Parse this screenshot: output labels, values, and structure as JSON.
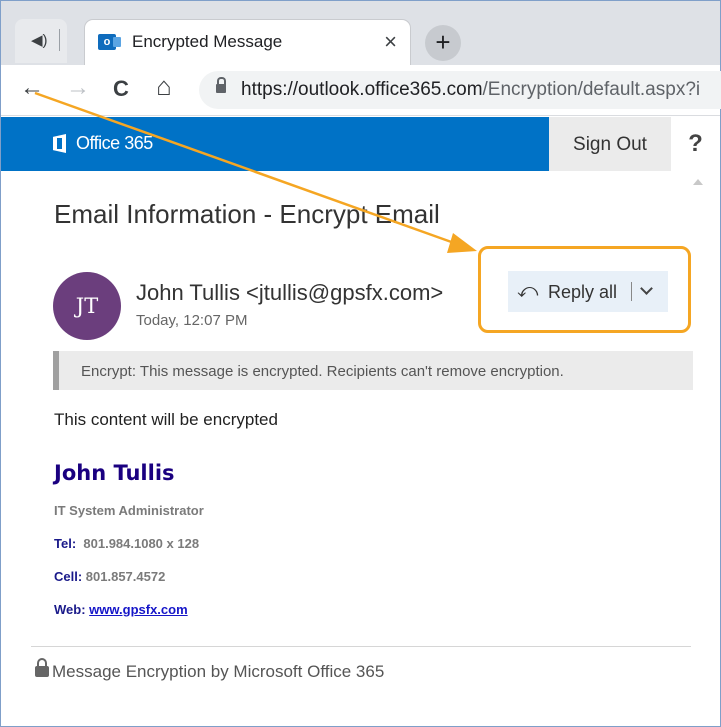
{
  "browser": {
    "tab_title": "Encrypted Message",
    "tab_close": "×",
    "new_tab": "+",
    "nav": {
      "back": "←",
      "forward": "→",
      "reload": "C",
      "home": "⌂"
    },
    "url_host": "https://outlook.office365.com",
    "url_path": "/Encryption/default.aspx?i"
  },
  "header": {
    "brand": "Office 365",
    "sign_out": "Sign Out",
    "help": "?"
  },
  "page": {
    "title": "Email Information - Encrypt Email"
  },
  "message": {
    "avatar_initials": "JT",
    "avatar_color": "#6b3e7d",
    "sender": "John Tullis <jtullis@gpsfx.com>",
    "time": "Today, 12:07 PM",
    "reply_all": "Reply all",
    "encryption_notice": "Encrypt: This message is encrypted. Recipients can't remove encryption.",
    "body": "This content will be encrypted"
  },
  "signature": {
    "name": "John Tullis",
    "title": "IT System Administrator",
    "tel_label": "Tel:",
    "tel_value": "801.984.1080 x 128",
    "cell_label": "Cell:",
    "cell_value": "801.857.4572",
    "web_label": "Web:",
    "web_link": "www.gpsfx.com"
  },
  "footer": {
    "text": "Message Encryption by Microsoft Office 365"
  },
  "colors": {
    "office_blue": "#0072c6",
    "callout_orange": "#f5a623"
  }
}
